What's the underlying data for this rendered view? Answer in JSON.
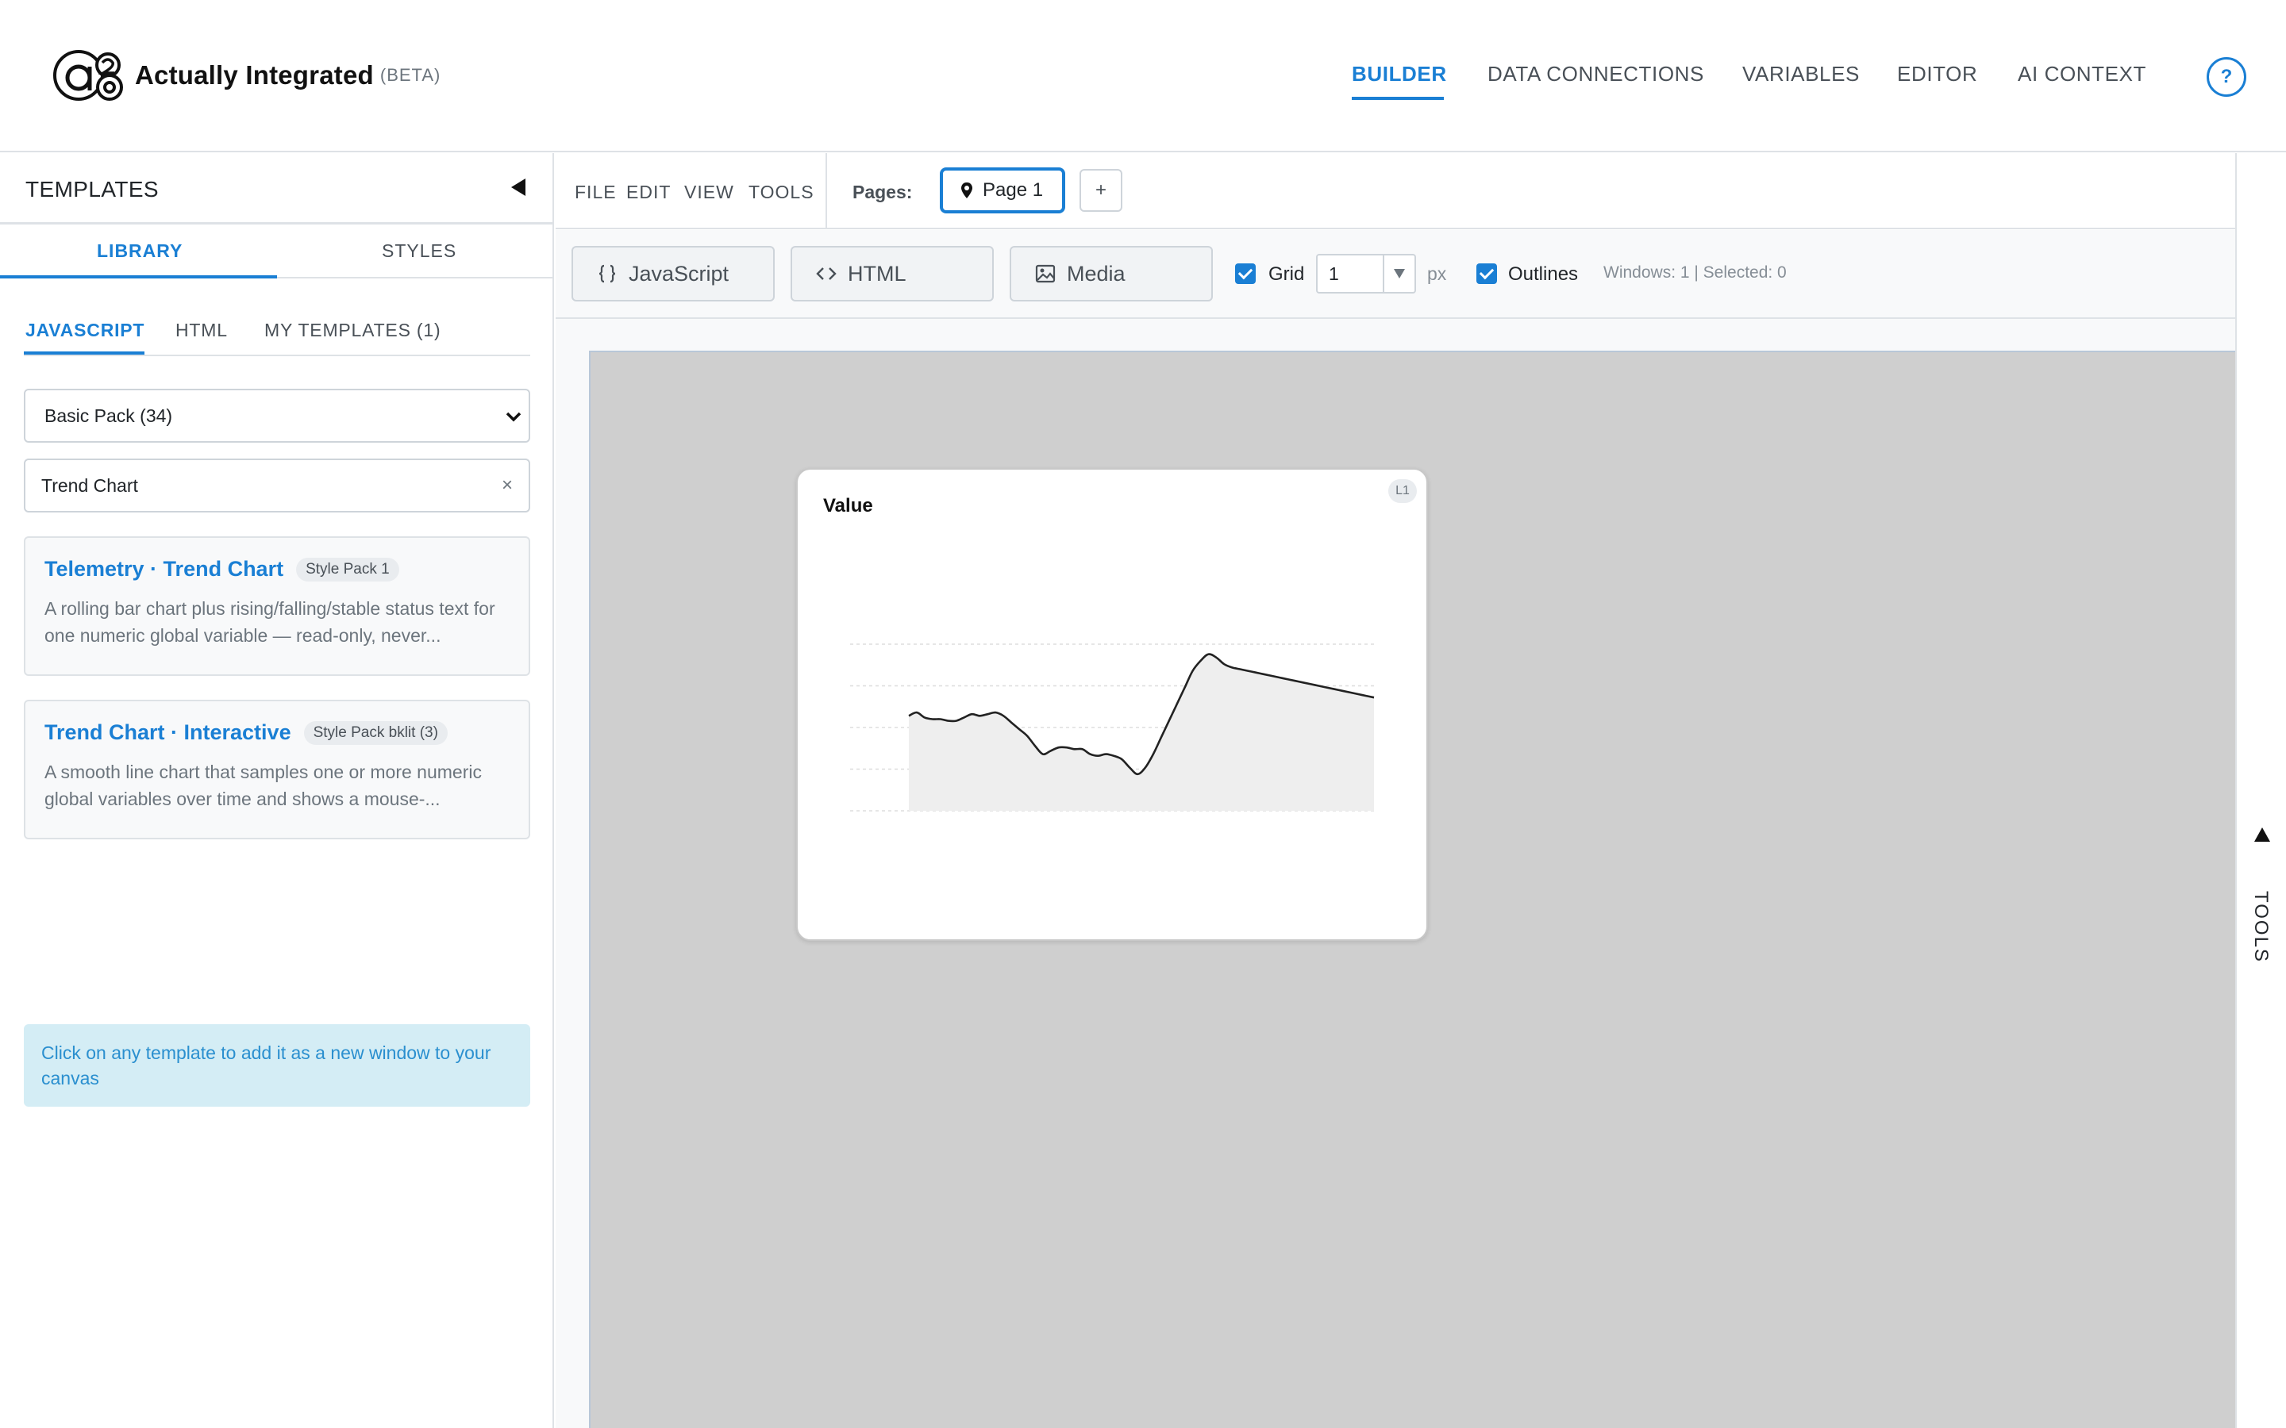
{
  "app": {
    "name": "Actually Integrated",
    "beta": "(BETA)",
    "logo_mark": "a2"
  },
  "nav": {
    "items": [
      {
        "label": "BUILDER",
        "active": true
      },
      {
        "label": "DATA CONNECTIONS",
        "active": false
      },
      {
        "label": "VARIABLES",
        "active": false
      },
      {
        "label": "EDITOR",
        "active": false
      },
      {
        "label": "AI CONTEXT",
        "active": false
      }
    ],
    "help": "?"
  },
  "sidebar": {
    "title": "TEMPLATES",
    "tabs": [
      "LIBRARY",
      "STYLES"
    ],
    "sub_tabs": [
      "JAVASCRIPT",
      "HTML",
      "MY TEMPLATES (1)"
    ],
    "pack_select": "Basic Pack (34)",
    "search_value": "Trend Chart",
    "clear": "×",
    "cards": [
      {
        "title": "Telemetry · Trend Chart",
        "badge": "Style Pack 1",
        "desc": "A rolling bar chart plus rising/falling/stable status text for one numeric global variable — read-only, never..."
      },
      {
        "title": "Trend Chart · Interactive",
        "badge": "Style Pack bklit (3)",
        "desc": "A smooth line chart that samples one or more numeric global variables over time and shows a mouse-..."
      }
    ],
    "hint": "Click on any template to add it as a new window to your canvas"
  },
  "menubar": {
    "items": [
      "FILE",
      "EDIT",
      "VIEW",
      "TOOLS"
    ],
    "pages_label": "Pages:",
    "page": "Page 1",
    "add_page": "+"
  },
  "toolbar": {
    "buttons": [
      {
        "label": "JavaScript",
        "icon": "braces-icon"
      },
      {
        "label": "HTML",
        "icon": "code-icon"
      },
      {
        "label": "Media",
        "icon": "image-icon"
      }
    ],
    "grid_label": "Grid",
    "grid_checked": true,
    "grid_value": "1",
    "grid_unit": "px",
    "outlines_label": "Outlines",
    "outlines_checked": true,
    "status": "Windows: 1 | Selected: 0"
  },
  "canvas": {
    "window": {
      "title": "Value",
      "badge": "L1"
    }
  },
  "chart_data": {
    "type": "area",
    "title": "Value",
    "x": [
      0,
      1,
      2,
      3,
      4,
      5,
      6,
      7,
      8,
      9,
      10,
      11,
      12,
      13,
      14,
      15,
      16,
      17,
      18,
      19,
      20,
      21,
      22,
      23,
      24,
      25,
      26,
      27,
      28,
      29,
      30,
      31,
      32,
      33,
      34,
      35,
      36,
      37,
      38,
      39,
      40,
      41,
      42,
      43,
      44,
      45,
      46,
      47,
      48,
      49,
      50,
      51,
      52,
      53,
      54,
      55,
      56,
      57,
      58,
      59
    ],
    "values": [
      57,
      59,
      56,
      55,
      55,
      54,
      54,
      56,
      58,
      57,
      58,
      59,
      57,
      53,
      49,
      45,
      39,
      34,
      36,
      38,
      38,
      37,
      37,
      34,
      33,
      34,
      33,
      31,
      26,
      22,
      26,
      34,
      44,
      54,
      64,
      74,
      84,
      90,
      94,
      92,
      88,
      86,
      85,
      84,
      83,
      82,
      81,
      80,
      79,
      78,
      77,
      76,
      75,
      74,
      73,
      72,
      71,
      70,
      69,
      68
    ],
    "ylim": [
      0,
      100
    ],
    "grid": true,
    "legend": "none"
  },
  "rail": {
    "label": "TOOLS"
  },
  "colors": {
    "accent": "#1a7fd4",
    "canvas_bg": "#cfcfcf",
    "hint_bg": "#d4edf5"
  }
}
